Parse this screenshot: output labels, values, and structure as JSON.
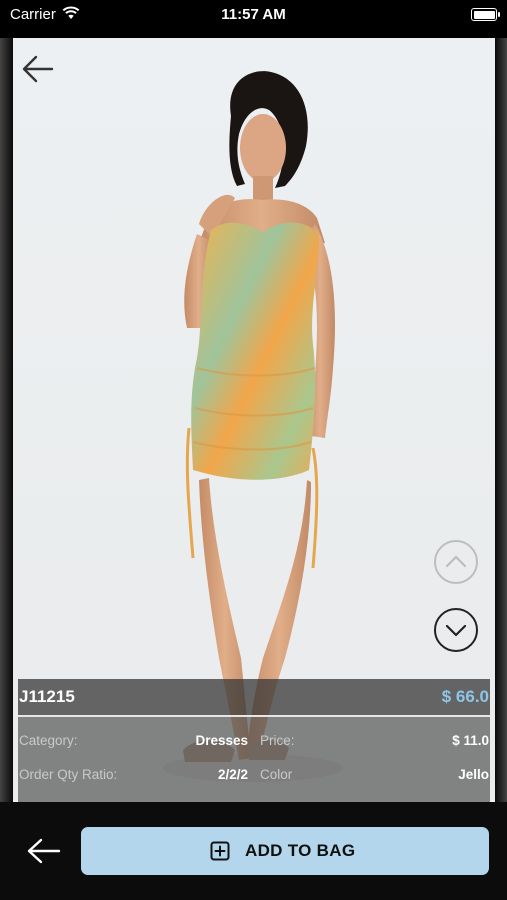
{
  "status_bar": {
    "carrier": "Carrier",
    "time": "11:57 AM"
  },
  "product": {
    "sku": "J11215",
    "price": "$ 66.0",
    "details": {
      "category_label": "Category:",
      "category_value": "Dresses",
      "price_label": "Price:",
      "price_value": "$ 11.0",
      "qty_label": "Order Qty Ratio:",
      "qty_value": "2/2/2",
      "color_label": "Color",
      "color_value": "Jello"
    }
  },
  "actions": {
    "add_to_bag": "ADD TO BAG"
  },
  "icons": {
    "back": "arrow-left-icon",
    "up": "chevron-up-icon",
    "down": "chevron-down-icon",
    "add": "plus-square-icon"
  },
  "colors": {
    "accent": "#b4d6ec",
    "price": "#8fc5e6"
  }
}
